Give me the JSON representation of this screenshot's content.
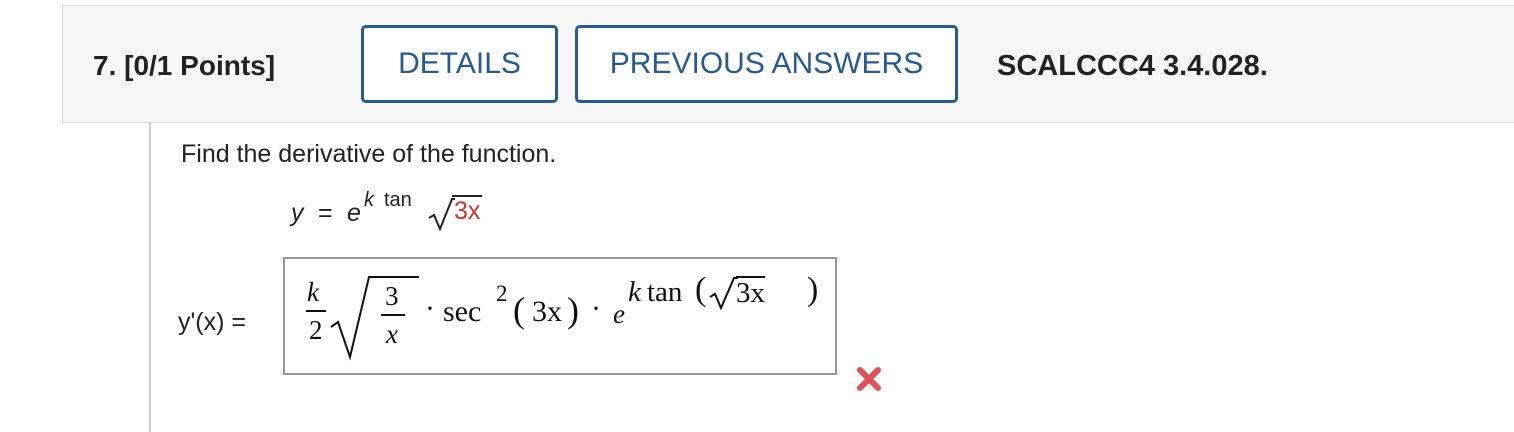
{
  "header": {
    "question_number": "7.  [0/1 Points]",
    "details_label": "DETAILS",
    "previous_answers_label": "PREVIOUS ANSWERS",
    "question_id": "SCALCCC4 3.4.028."
  },
  "question": {
    "prompt": "Find the derivative of the function.",
    "function": {
      "lhs": "y",
      "equals": "=",
      "base": "e",
      "exponent_k": "k",
      "exponent_tan": "tan",
      "radicand": "3x"
    }
  },
  "answer": {
    "label": "y'(x) =",
    "entered": {
      "coef_num": "k",
      "coef_den": "2",
      "sqrt_num": "3",
      "sqrt_den": "x",
      "dot1": "·",
      "sec": "sec",
      "sec_power": "2",
      "sec_arg_open": "(",
      "sec_arg": "3x",
      "sec_arg_close": ")",
      "dot2": "·",
      "base": "e",
      "exp_k": "k",
      "exp_tan": "tan",
      "exp_open": "(",
      "exp_radicand": "3x",
      "exp_close": ")"
    },
    "status": "incorrect",
    "status_icon": "x-mark-icon",
    "status_color": "#e0525a"
  },
  "colors": {
    "accent": "#2a5a8c",
    "highlight_red": "#c0392b"
  }
}
